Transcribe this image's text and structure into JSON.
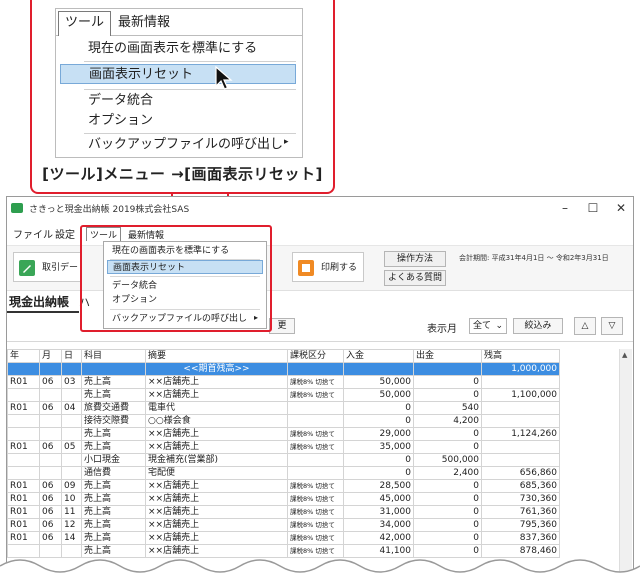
{
  "callout": {
    "tabs": [
      "ツール",
      "最新情報"
    ],
    "items": [
      "現在の画面表示を標準にする",
      "画面表示リセット",
      "データ統合",
      "オプション",
      "バックアップファイルの呼び出し"
    ],
    "caption": "[ツール]メニュー →[画面表示リセット]"
  },
  "window": {
    "title": "さきっと現金出納帳 2019株式会社SAS",
    "controls": [
      "–",
      "☐",
      "✕"
    ],
    "menubar": [
      "ファイル",
      "設定",
      "ツール",
      "最新情報"
    ],
    "toolbar": {
      "record_btn": "取引デー",
      "print_btn": "印刷する",
      "howto_btn": "操作方法",
      "faq_btn": "よくある質問",
      "period": "会計期間: 平成31年4月1日 ～ 令和2年3月31日"
    },
    "tab_title": "現金出納帳",
    "tab_next": "ハ",
    "hidden_btn": "更",
    "filter": {
      "label": "表示月",
      "value": "全て",
      "apply_btn": "絞込み",
      "up": "△",
      "down": "▽"
    },
    "menu": {
      "tabs": [
        "ツール",
        "最新情報"
      ],
      "items": [
        "現在の画面表示を標準にする",
        "画面表示リセット",
        "データ統合",
        "オプション",
        "バックアップファイルの呼び出し"
      ],
      "arrow": "▸"
    },
    "grid": {
      "headers": [
        "年",
        "月",
        "日",
        "科目",
        "摘要",
        "課税区分",
        "入金",
        "出金",
        "残高"
      ],
      "rows": [
        [
          "",
          "",
          "",
          "",
          "<<期首残高>>",
          "",
          "",
          "",
          "1,000,000"
        ],
        [
          "R01",
          "06",
          "03",
          "売上高",
          "××店舗売上",
          "課税8% 切捨て",
          "50,000",
          "0",
          ""
        ],
        [
          "",
          "",
          "",
          "売上高",
          "××店舗売上",
          "課税8% 切捨て",
          "50,000",
          "0",
          "1,100,000"
        ],
        [
          "R01",
          "06",
          "04",
          "旅費交通費",
          "電車代",
          "",
          "0",
          "540",
          ""
        ],
        [
          "",
          "",
          "",
          "接待交際費",
          "○○様会食",
          "",
          "0",
          "4,200",
          ""
        ],
        [
          "",
          "",
          "",
          "売上高",
          "××店舗売上",
          "課税8% 切捨て",
          "29,000",
          "0",
          "1,124,260"
        ],
        [
          "R01",
          "06",
          "05",
          "売上高",
          "××店舗売上",
          "課税8% 切捨て",
          "35,000",
          "0",
          ""
        ],
        [
          "",
          "",
          "",
          "小口現金",
          "現金補充(営業部)",
          "",
          "0",
          "500,000",
          ""
        ],
        [
          "",
          "",
          "",
          "通信費",
          "宅配便",
          "",
          "0",
          "2,400",
          "656,860"
        ],
        [
          "R01",
          "06",
          "09",
          "売上高",
          "××店舗売上",
          "課税8% 切捨て",
          "28,500",
          "0",
          "685,360"
        ],
        [
          "R01",
          "06",
          "10",
          "売上高",
          "××店舗売上",
          "課税8% 切捨て",
          "45,000",
          "0",
          "730,360"
        ],
        [
          "R01",
          "06",
          "11",
          "売上高",
          "××店舗売上",
          "課税8% 切捨て",
          "31,000",
          "0",
          "761,360"
        ],
        [
          "R01",
          "06",
          "12",
          "売上高",
          "××店舗売上",
          "課税8% 切捨て",
          "34,000",
          "0",
          "795,360"
        ],
        [
          "R01",
          "06",
          "14",
          "売上高",
          "××店舗売上",
          "課税8% 切捨て",
          "42,000",
          "0",
          "837,360"
        ],
        [
          "",
          "",
          "",
          "売上高",
          "××店舗売上",
          "課税8% 切捨て",
          "41,100",
          "0",
          "878,460"
        ]
      ]
    }
  },
  "colors": {
    "accent_red": "#e01e2d",
    "selection_blue": "#3c8de1",
    "highlight": "#c7e0f4"
  }
}
